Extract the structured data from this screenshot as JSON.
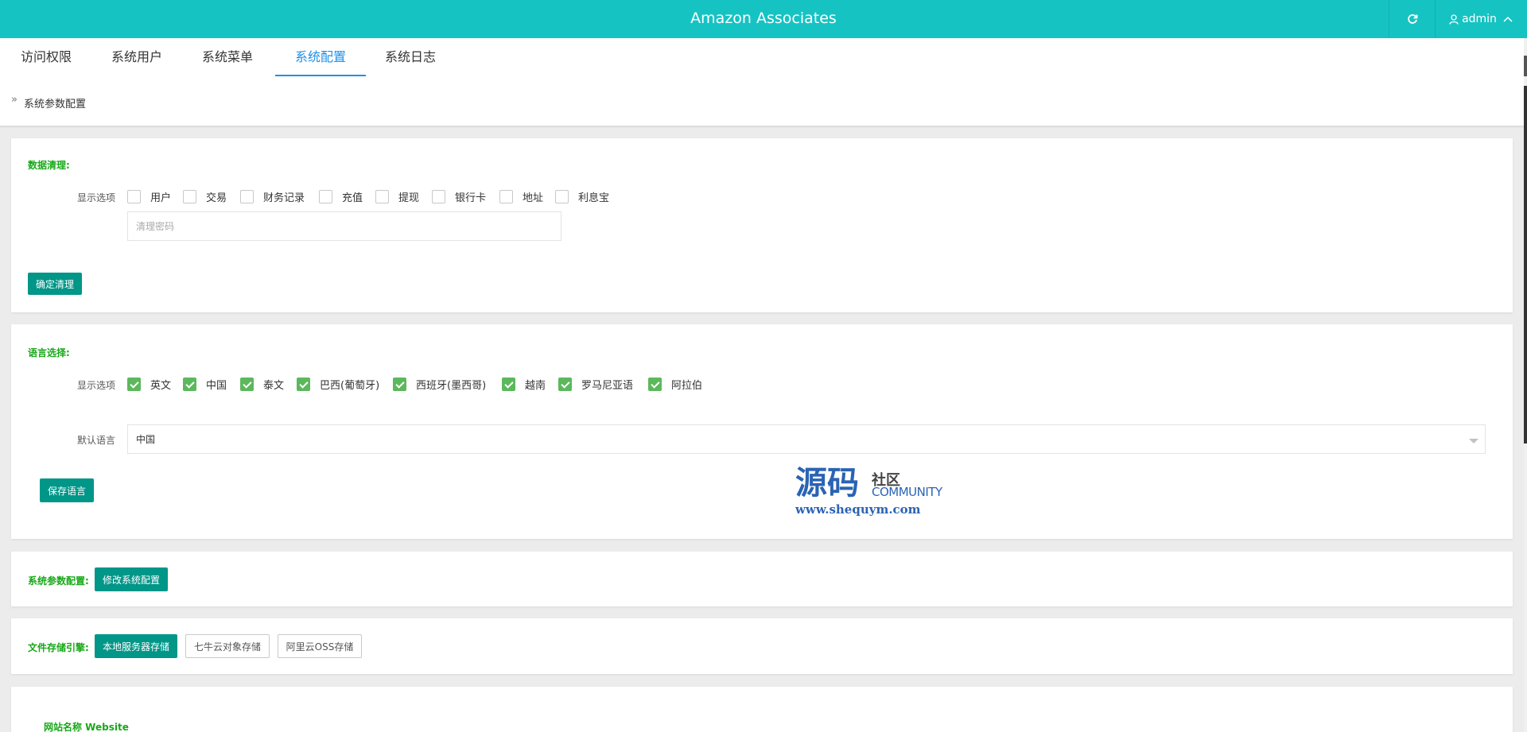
{
  "header": {
    "title": "Amazon Associates",
    "refresh_icon": "refresh-icon",
    "user_icon": "user-icon",
    "user_name": "admin",
    "user_caret_icon": "chevron-up-icon"
  },
  "nav": {
    "tabs": [
      {
        "label": "访问权限"
      },
      {
        "label": "系统用户"
      },
      {
        "label": "系统菜单"
      },
      {
        "label": "系统配置",
        "active": true
      },
      {
        "label": "系统日志"
      }
    ],
    "active_color": "#1e90e8"
  },
  "breadcrumb": {
    "text": "系统参数配置"
  },
  "data_clean": {
    "title": "数据清理:",
    "options_label": "显示选项",
    "options": [
      "用户",
      "交易",
      "财务记录",
      "充值",
      "提现",
      "银行卡",
      "地址",
      "利息宝"
    ],
    "password_placeholder": "清理密码",
    "confirm_button": "确定清理"
  },
  "language": {
    "title": "语言选择:",
    "options_label": "显示选项",
    "options": [
      "英文",
      "中国",
      "泰文",
      "巴西(葡萄牙)",
      "西班牙(墨西哥)",
      "越南",
      "罗马尼亚语",
      "阿拉伯"
    ],
    "default_label": "默认语言",
    "default_value": "中国",
    "save_button": "保存语言"
  },
  "watermark": {
    "big_text": "源码",
    "small_text_1": "社区",
    "small_text_2": "COMMUNITY",
    "url": "www.shequym.com"
  },
  "system_params": {
    "title": "系统参数配置:",
    "edit_button": "修改系统配置"
  },
  "storage": {
    "title": "文件存储引擎:",
    "buttons": [
      "本地服务器存储",
      "七牛云对象存储",
      "阿里云OSS存储"
    ]
  },
  "website": {
    "title": "网站名称 Website"
  },
  "colors": {
    "header_bg": "#16c3c3",
    "section_title": "#18a818",
    "primary_button": "#009688",
    "checkbox_checked": "#5cb85c"
  }
}
